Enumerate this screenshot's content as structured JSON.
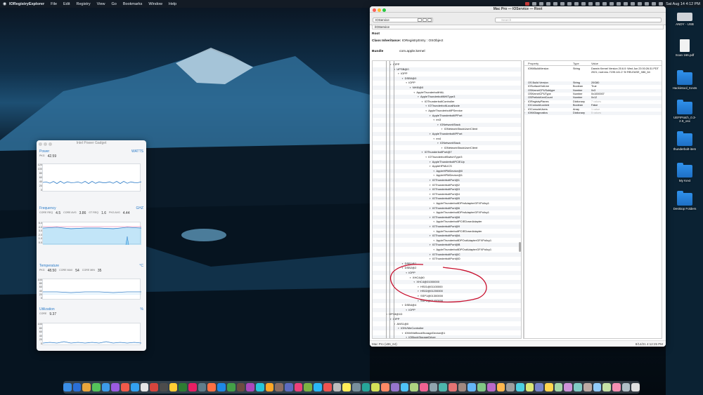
{
  "menubar": {
    "app_name": "IORegistryExplorer",
    "items": [
      "File",
      "Edit",
      "Registry",
      "View",
      "Go",
      "Bookmarks",
      "Window",
      "Help"
    ],
    "clock": "Sat Aug 14  4:12 PM"
  },
  "power_gadget": {
    "title": "Intel Power Gadget",
    "power": {
      "title": "Power",
      "unit": "WATTS",
      "label": "PKG",
      "value": "42.59",
      "yticks": [
        "120",
        "100",
        "80",
        "60",
        "40",
        "20",
        "0"
      ],
      "level": 0.35
    },
    "frequency": {
      "title": "Frequency",
      "unit": "GHZ",
      "readouts": [
        {
          "label": "CORE REQ",
          "value": "4.5"
        },
        {
          "label": "CORE AVG",
          "value": "3.86"
        },
        {
          "label": "GT REQ",
          "value": "1.6"
        },
        {
          "label": "PKG AVG",
          "value": "4.44"
        }
      ],
      "yticks": [
        "5.0",
        "4.0",
        "3.0",
        "2.0",
        "1.0",
        "0.0"
      ]
    },
    "temperature": {
      "title": "Temperature",
      "unit": "°C",
      "readouts": [
        {
          "label": "PKG",
          "value": "48.50"
        },
        {
          "label": "CORE MAX",
          "value": "54"
        },
        {
          "label": "CORE MIN",
          "value": "35"
        }
      ],
      "yticks": [
        "100",
        "80",
        "60",
        "40",
        "20",
        "0"
      ]
    },
    "utilization": {
      "title": "Utilization",
      "unit": "%",
      "label": "CORE",
      "value": "9.37",
      "yticks": [
        "100",
        "80",
        "60",
        "40",
        "20",
        "0"
      ]
    }
  },
  "ioreg": {
    "title": "Mac Pro — IOService — Root",
    "plane": "IOService",
    "search_placeholder": "Search",
    "path": "/IOService",
    "root_label": "Root",
    "class_inheritance_label": "Class Inheritance:",
    "class_inheritance_value": "IORegistryEntry : OSObject",
    "bundle_label": "Bundle",
    "bundle_value": "com.apple.kernel",
    "tree": [
      {
        "d": 0,
        "t": "IOPP"
      },
      {
        "d": 1,
        "t": "UPSB@0"
      },
      {
        "d": 2,
        "t": "IOPP"
      },
      {
        "d": 3,
        "t": "DSB0@0"
      },
      {
        "d": 4,
        "t": "IOPP"
      },
      {
        "d": 5,
        "t": "NHI0@0"
      },
      {
        "d": 6,
        "t": "AppleThunderboltHAL"
      },
      {
        "d": 7,
        "t": "AppleThunderboltNHIType3"
      },
      {
        "d": 8,
        "t": "IOThunderboltController"
      },
      {
        "d": 9,
        "t": "IOThunderboltLocalNode"
      },
      {
        "d": 9,
        "t": "AppleThunderboltIPService"
      },
      {
        "d": 10,
        "t": "AppleThunderboltIPPort"
      },
      {
        "d": 11,
        "t": "en3"
      },
      {
        "d": 12,
        "t": "IONetworkStack"
      },
      {
        "d": 13,
        "t": "IONetworkStackUserClient"
      },
      {
        "d": 10,
        "t": "AppleThunderboltIPPort"
      },
      {
        "d": 11,
        "t": "en4"
      },
      {
        "d": 12,
        "t": "IONetworkStack"
      },
      {
        "d": 13,
        "t": "IONetworkStackUserClient"
      },
      {
        "d": 8,
        "t": "IOThunderboltPort@7"
      },
      {
        "d": 9,
        "t": "IOThunderboltSwitchType3"
      },
      {
        "d": 10,
        "t": "AppleThunderboltPCIEUp"
      },
      {
        "d": 10,
        "t": "AppleHPMLICS"
      },
      {
        "d": 11,
        "t": "AppleHPMDevice@0"
      },
      {
        "d": 11,
        "t": "AppleHPMDevice@1"
      },
      {
        "d": 10,
        "t": "IOThunderboltPort@1"
      },
      {
        "d": 10,
        "t": "IOThunderboltPort@2"
      },
      {
        "d": 10,
        "t": "IOThunderboltPort@3"
      },
      {
        "d": 10,
        "t": "IOThunderboltPort@4"
      },
      {
        "d": 10,
        "t": "IOThunderboltPort@5"
      },
      {
        "d": 11,
        "t": "AppleThunderboltDPInAdapterGFXPolicy1"
      },
      {
        "d": 10,
        "t": "IOThunderboltPort@6"
      },
      {
        "d": 11,
        "t": "AppleThunderboltDPInAdapterGFXPolicy1"
      },
      {
        "d": 10,
        "t": "IOThunderboltPort@8"
      },
      {
        "d": 11,
        "t": "AppleThunderboltPCIEDownAdapter"
      },
      {
        "d": 10,
        "t": "IOThunderboltPort@9"
      },
      {
        "d": 11,
        "t": "AppleThunderboltPCIEDownAdapter"
      },
      {
        "d": 10,
        "t": "IOThunderboltPort@A"
      },
      {
        "d": 11,
        "t": "AppleThunderboltDPOutAdapterGFXPolicy1"
      },
      {
        "d": 10,
        "t": "IOThunderboltPort@B"
      },
      {
        "d": 11,
        "t": "AppleThunderboltDPOutAdapterGFXPolicy1"
      },
      {
        "d": 10,
        "t": "IOThunderboltPort@C"
      },
      {
        "d": 10,
        "t": "IOThunderboltPort@D"
      },
      {
        "d": 3,
        "t": "DSB1@1"
      },
      {
        "d": 3,
        "t": "DSB2@2"
      },
      {
        "d": 4,
        "t": "IOPP"
      },
      {
        "d": 5,
        "t": "XHC4@0"
      },
      {
        "d": 6,
        "t": "XHC4@01000000"
      },
      {
        "d": 7,
        "t": "HS01@01100000"
      },
      {
        "d": 7,
        "t": "HS02@01200000"
      },
      {
        "d": 7,
        "t": "SSP1@01300000"
      },
      {
        "d": 7,
        "t": "SSP2@01400000"
      },
      {
        "d": 3,
        "t": "DSB4@4"
      },
      {
        "d": 4,
        "t": "IOPP"
      },
      {
        "d": -1,
        "t": "RP08@1D"
      },
      {
        "d": 0,
        "t": "IOPP"
      },
      {
        "d": 1,
        "t": "ANS1@0"
      },
      {
        "d": 2,
        "t": "IONVMeController"
      },
      {
        "d": 3,
        "t": "IONVMeBlockStorageDevice@1"
      },
      {
        "d": 4,
        "t": "IOBlockStorageDriver"
      },
      {
        "d": 5,
        "t": "ADATA SX8200PNP Media"
      },
      {
        "d": 6,
        "t": "IOGUIDPartitionScheme"
      }
    ],
    "prop_headers": [
      "Property",
      "Type",
      "Value"
    ],
    "props": [
      {
        "p": "IOKitBuildVersion",
        "ty": "String",
        "v": "Darwin Kernel Version 20.6.0: Wed Jun 23 00:26:31 PDT 2021; root:xnu-7195.141.2~5/ RELEASE_X86_64",
        "lines": 4
      },
      {
        "p": "OS Build Version",
        "ty": "String",
        "v": "20G80",
        "lines": 1
      },
      {
        "p": "IOSurfaceHotLine",
        "ty": "Boolean",
        "v": "True",
        "lines": 1
      },
      {
        "p": "OSKernelCPUSubtype",
        "ty": "Number",
        "v": "0x3",
        "lines": 1
      },
      {
        "p": "OSKernelCPUType",
        "ty": "Number",
        "v": "0x1000007",
        "lines": 1
      },
      {
        "p": "OSPrelinkKextCount",
        "ty": "Number",
        "v": "0x12",
        "lines": 1
      },
      {
        "p": "IORegistryPlanes",
        "ty": "Dictionary",
        "v": "7 values",
        "lines": 1,
        "exp": true
      },
      {
        "p": "IOConsoleLocked",
        "ty": "Boolean",
        "v": "False",
        "lines": 1
      },
      {
        "p": "IOConsoleUsers",
        "ty": "Array",
        "v": "1 value",
        "lines": 1,
        "exp": true
      },
      {
        "p": "IOKitDiagnostics",
        "ty": "Dictionary",
        "v": "5 values",
        "lines": 1,
        "exp": true
      }
    ],
    "status_left": "Mac Pro (x86_64)",
    "status_right": "8/14/21 4:12:25 PM"
  },
  "desktop_icons": [
    {
      "label": "ANDY - USB",
      "kind": "drive"
    },
    {
      "label": "Scan 166.pdf",
      "kind": "doc"
    },
    {
      "label": "Hackintool_Kexts",
      "kind": "folder"
    },
    {
      "label": "UEFIPatch_0.3-2.9_osx",
      "kind": "folder"
    },
    {
      "label": "thunderbolt-item",
      "kind": "folder"
    },
    {
      "label": "My Kext",
      "kind": "folder"
    },
    {
      "label": "Desktop Folders",
      "kind": "folder"
    }
  ],
  "colors": {
    "accent": "#2d7cc8",
    "annotation": "#c8102e",
    "dock_icons": [
      "#3a8ee6",
      "#2a6fd6",
      "#e9a63b",
      "#55c35a",
      "#3d9be9",
      "#9a5be0",
      "#f05a4a",
      "#33a1f0",
      "#e6e6e6",
      "#d6453d",
      "#4c4c4c",
      "#ffcc33",
      "#2e7d32",
      "#e91e63",
      "#607d8b",
      "#ff7043",
      "#1e88e5",
      "#43a047",
      "#6d4c41",
      "#ab47bc",
      "#26c6da",
      "#ffa726",
      "#8d6e63",
      "#5c6bc0",
      "#ec407a",
      "#7cb342",
      "#29b6f6",
      "#ef5350",
      "#bdbdbd",
      "#ffee58",
      "#78909c",
      "#26a69a",
      "#d4e157",
      "#ff8a65",
      "#9575cd",
      "#4fc3f7",
      "#aed581",
      "#f06292",
      "#90a4ae",
      "#4db6ac",
      "#e57373",
      "#a1887f",
      "#64b5f6",
      "#81c784",
      "#ba68c8",
      "#ffb74d",
      "#9e9e9e",
      "#4dd0e1",
      "#dce775",
      "#7986cb",
      "#ffd54f",
      "#a5d6a7",
      "#ce93d8",
      "#80cbc4",
      "#bcaaa4",
      "#90caf9",
      "#c5e1a5",
      "#f48fb1",
      "#b0bec5",
      "#e0e0e0"
    ]
  }
}
